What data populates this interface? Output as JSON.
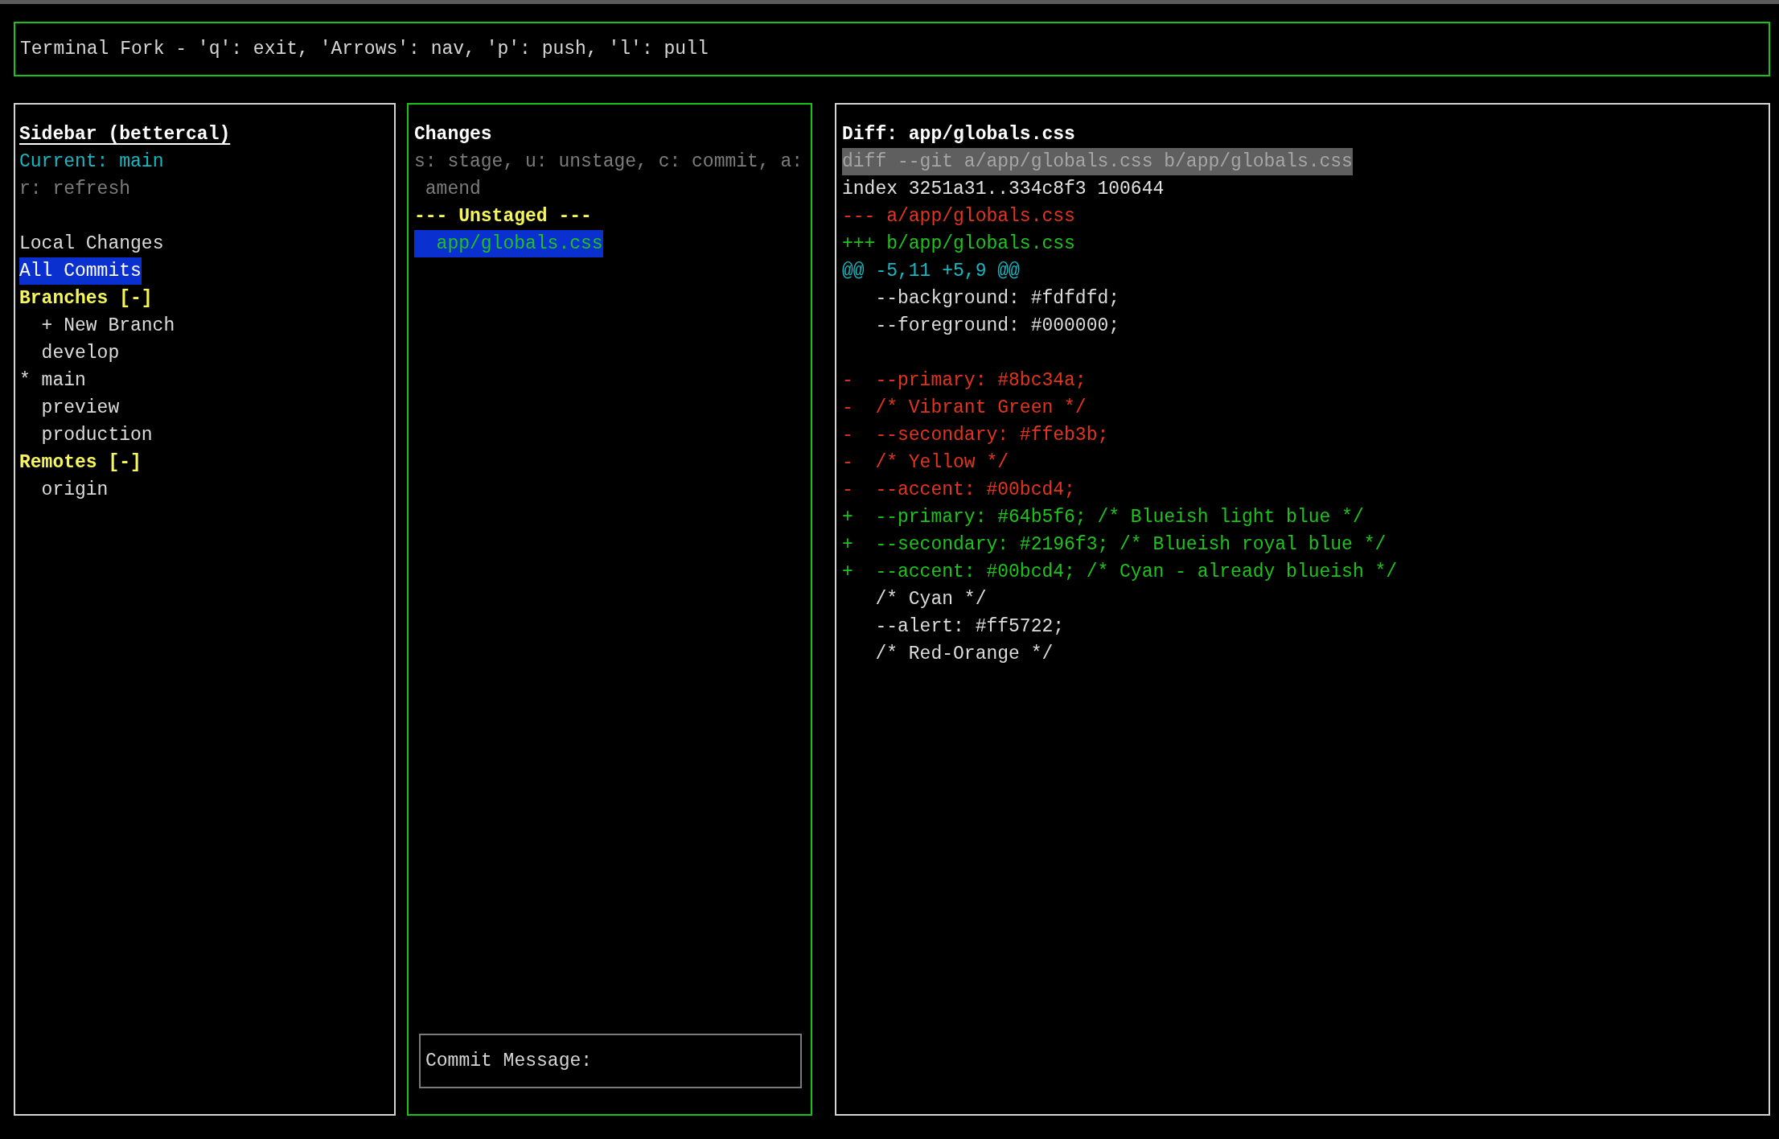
{
  "header": {
    "text": "Terminal Fork - 'q': exit, 'Arrows': nav, 'p': push, 'l': pull"
  },
  "sidebar": {
    "focused": false,
    "title": "Sidebar (bettercal)",
    "current": "Current: main",
    "hint": "r: refresh",
    "views": [
      {
        "label": "Local Changes",
        "selected": false
      },
      {
        "label": "All Commits",
        "selected": true
      }
    ],
    "sections": [
      {
        "title": "Branches [-]",
        "selected": false,
        "items": [
          {
            "label": "+ New Branch",
            "selected": false
          },
          {
            "label": "develop",
            "selected": false
          },
          {
            "marker": "*",
            "label": "main",
            "selected": false
          },
          {
            "label": "preview",
            "selected": false
          },
          {
            "label": "production",
            "selected": false
          }
        ]
      },
      {
        "title": "Remotes [-]",
        "selected": false,
        "items": [
          {
            "label": "origin",
            "selected": false
          }
        ]
      }
    ]
  },
  "changes": {
    "focused": true,
    "title": "Changes",
    "hint": "s: stage, u: unstage, c: commit, a: amend",
    "groups": [
      {
        "title": "--- Unstaged ---",
        "files": [
          {
            "path": "app/globals.css",
            "selected": true
          }
        ]
      }
    ],
    "commit_field": {
      "prompt": "Commit Message:"
    }
  },
  "diff": {
    "focused": false,
    "title": "Diff: app/globals.css",
    "lines": [
      {
        "kind": "header",
        "text": "diff --git a/app/globals.css b/app/globals.css"
      },
      {
        "kind": "meta",
        "text": "index 3251a31..334c8f3 100644"
      },
      {
        "kind": "removed",
        "text": "--- a/app/globals.css"
      },
      {
        "kind": "added",
        "text": "+++ b/app/globals.css"
      },
      {
        "kind": "hunk",
        "text": "@@ -5,11 +5,9 @@"
      },
      {
        "kind": "context",
        "text": "   --background: #fdfdfd;"
      },
      {
        "kind": "context",
        "text": "   --foreground: #000000;"
      },
      {
        "kind": "blank"
      },
      {
        "kind": "removed",
        "text": "-  --primary: #8bc34a;"
      },
      {
        "kind": "removed",
        "text": "-  /* Vibrant Green */"
      },
      {
        "kind": "removed",
        "text": "-  --secondary: #ffeb3b;"
      },
      {
        "kind": "removed",
        "text": "-  /* Yellow */"
      },
      {
        "kind": "removed",
        "text": "-  --accent: #00bcd4;"
      },
      {
        "kind": "added",
        "text": "+  --primary: #64b5f6; /* Blueish light blue */"
      },
      {
        "kind": "added",
        "text": "+  --secondary: #2196f3; /* Blueish royal blue */"
      },
      {
        "kind": "added",
        "text": "+  --accent: #00bcd4; /* Cyan - already blueish */"
      },
      {
        "kind": "context",
        "text": "   /* Cyan */"
      },
      {
        "kind": "context",
        "text": "   --alert: #ff5722;"
      },
      {
        "kind": "context",
        "text": "   /* Red-Orange */"
      }
    ]
  }
}
